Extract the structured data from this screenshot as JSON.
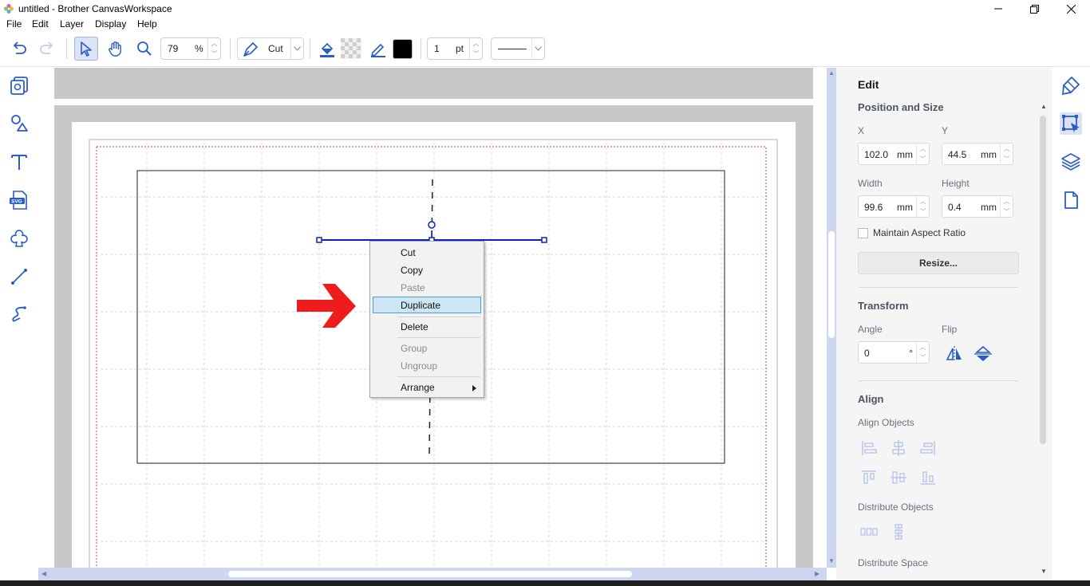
{
  "window": {
    "title": "untitled - Brother CanvasWorkspace"
  },
  "menu": [
    "File",
    "Edit",
    "Layer",
    "Display",
    "Help"
  ],
  "toolbar": {
    "zoom_value": "79",
    "zoom_unit": "%",
    "mode_label": "Cut",
    "line_width_value": "1",
    "line_width_unit": "pt"
  },
  "context_menu": {
    "items": [
      "Cut",
      "Copy",
      "Paste",
      "Duplicate",
      "Delete",
      "Group",
      "Ungroup",
      "Arrange"
    ],
    "disabled": [
      "Paste",
      "Group",
      "Ungroup"
    ],
    "highlighted": "Duplicate"
  },
  "panel": {
    "title": "Edit",
    "position_size_heading": "Position and Size",
    "x_label": "X",
    "y_label": "Y",
    "x_value": "102.0",
    "y_value": "44.5",
    "width_label": "Width",
    "height_label": "Height",
    "width_value": "99.6",
    "height_value": "0.4",
    "unit": "mm",
    "maintain_aspect": "Maintain Aspect Ratio",
    "resize_button": "Resize...",
    "transform_heading": "Transform",
    "angle_label": "Angle",
    "flip_label": "Flip",
    "angle_value": "0",
    "angle_unit": "°",
    "align_heading": "Align",
    "align_objects_label": "Align Objects",
    "distribute_objects_label": "Distribute Objects",
    "distribute_space_label": "Distribute Space"
  },
  "colors": {
    "accent": "#2b5cc4",
    "selection": "#0a22c0",
    "arrow": "#ee1c1c",
    "scrollbar": "#cdd6ef"
  }
}
